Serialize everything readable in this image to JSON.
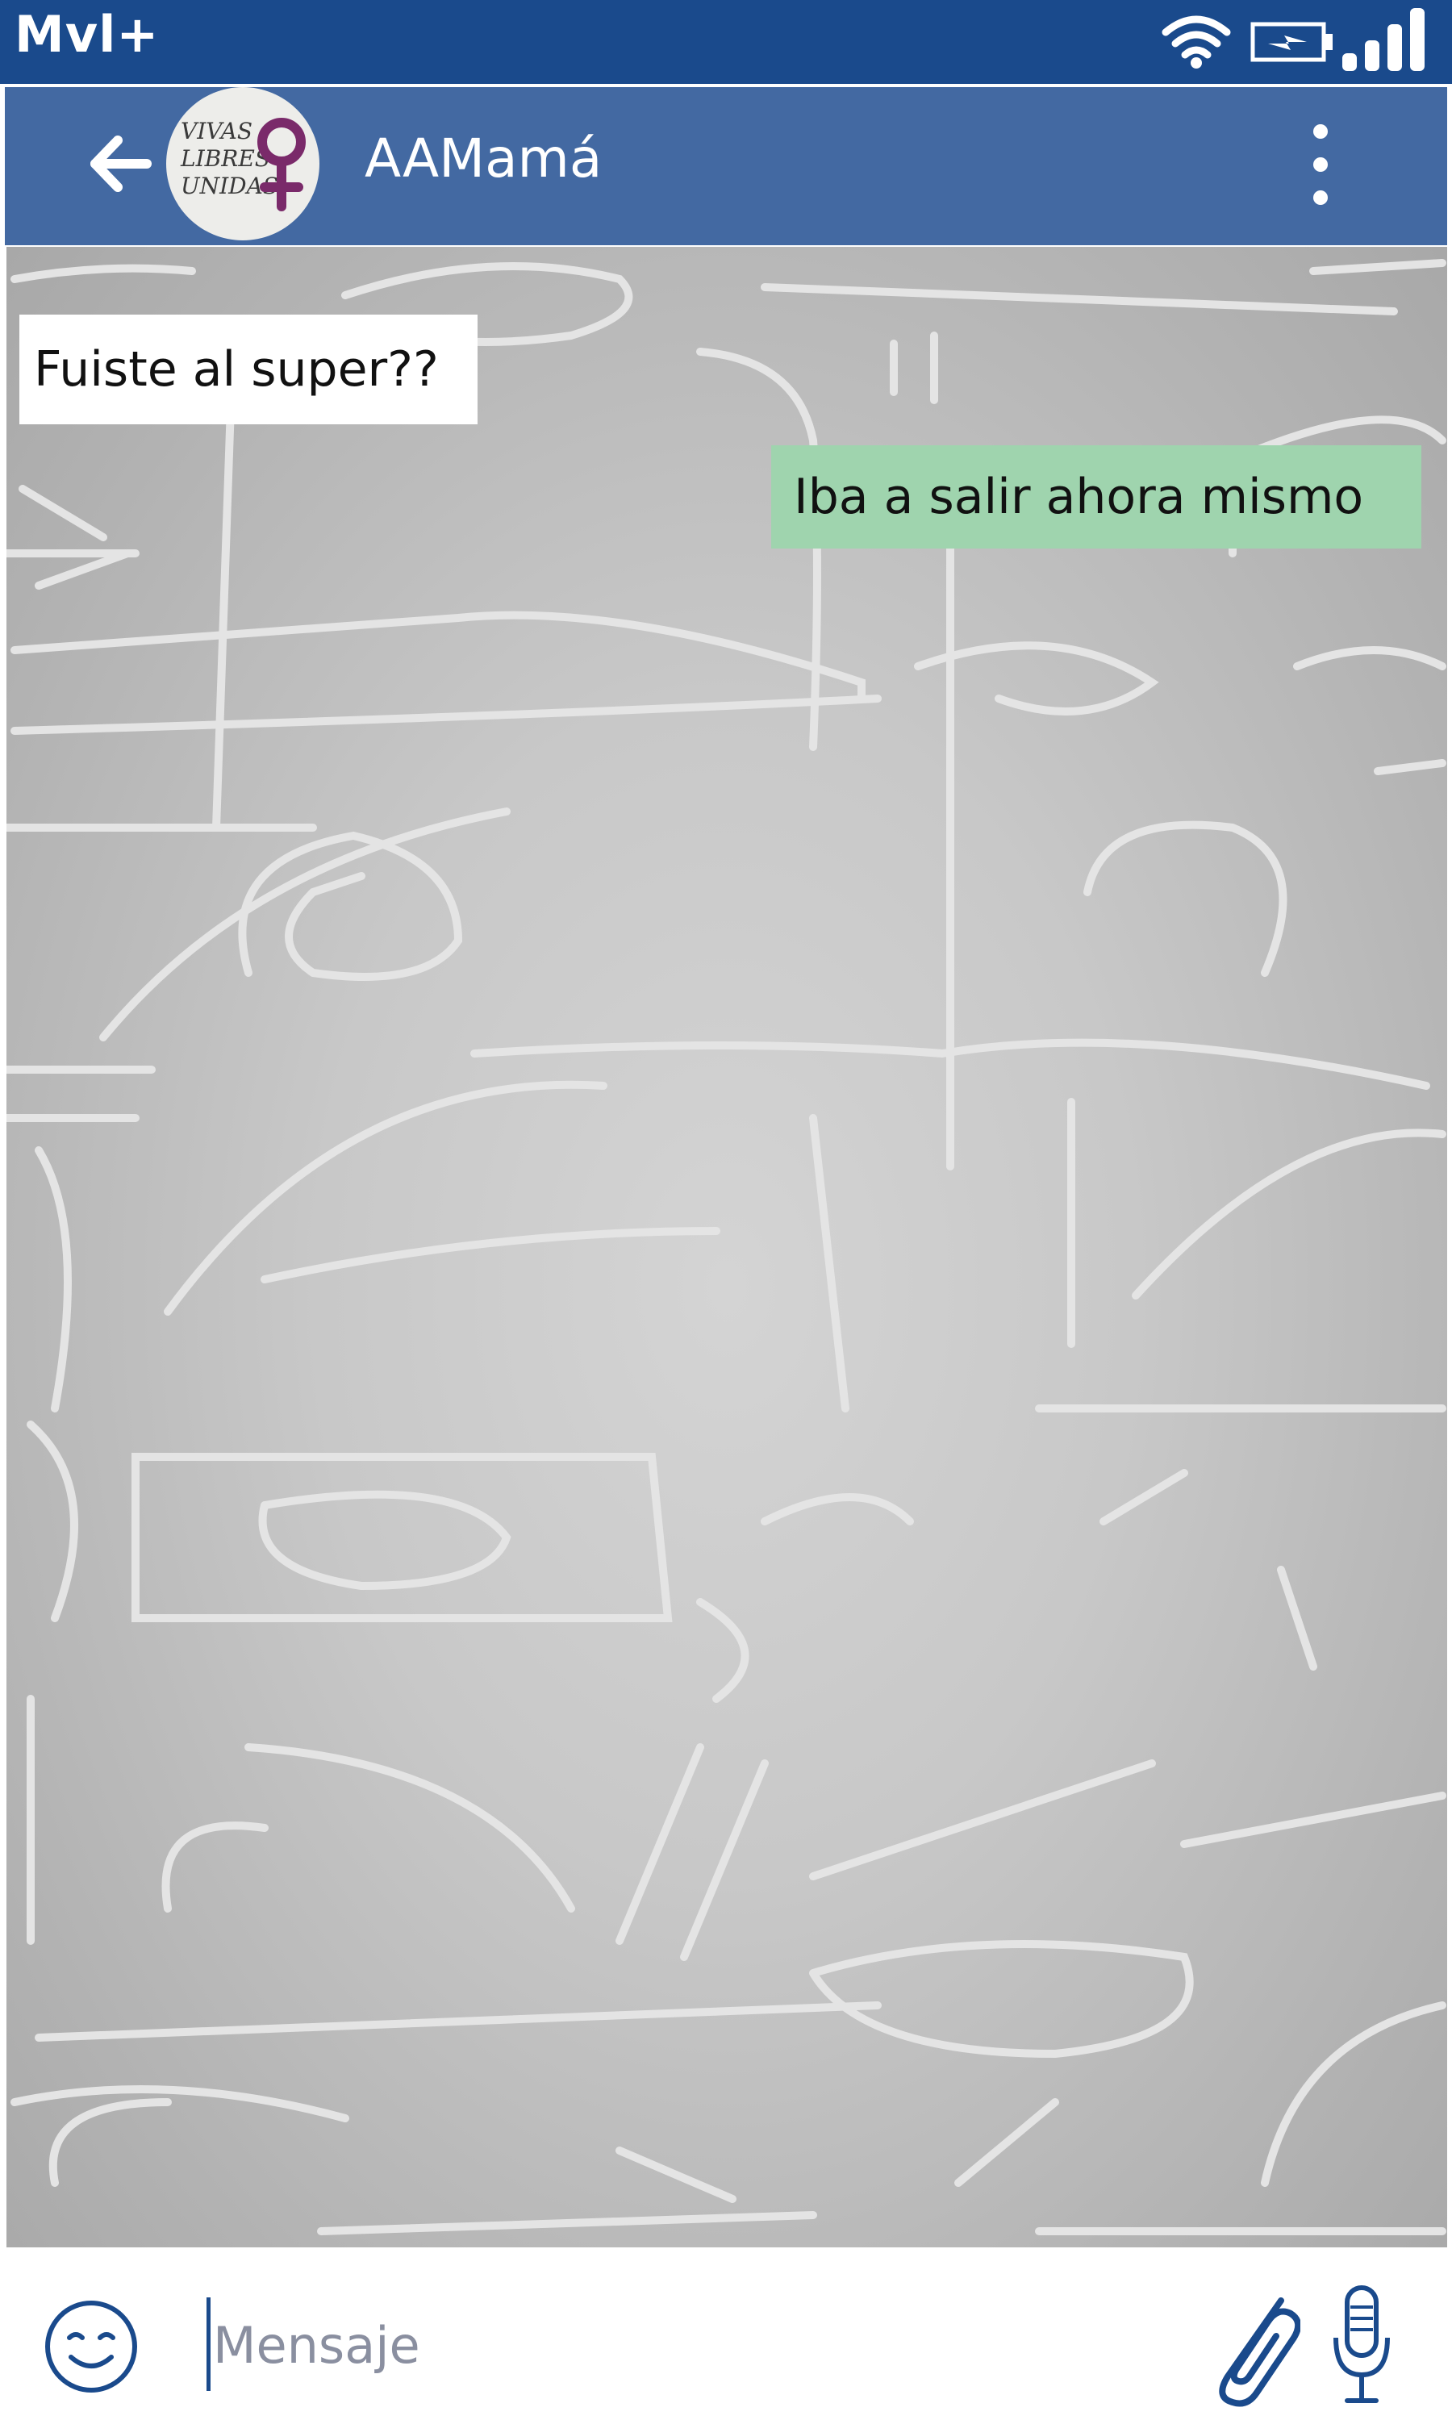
{
  "status_bar": {
    "carrier": "Mvl+",
    "icons": [
      "wifi-icon",
      "battery-charging-icon",
      "signal-icon"
    ]
  },
  "header": {
    "back_icon": "arrow-left-icon",
    "avatar_text": [
      "VIVAS",
      "LIBRES",
      "UNIDAS"
    ],
    "contact_name": "AAMamá",
    "menu_icon": "more-vertical-icon"
  },
  "messages": [
    {
      "direction": "incoming",
      "text": "Fuiste al super??"
    },
    {
      "direction": "outgoing",
      "text": "Iba a salir ahora mismo"
    }
  ],
  "composer": {
    "emoji_icon": "smiley-icon",
    "placeholder": "Mensaje",
    "value": "",
    "attach_icon": "paperclip-icon",
    "mic_icon": "microphone-icon"
  },
  "colors": {
    "status_bar": "#1a4a8c",
    "header": "#4369a2",
    "incoming_bubble": "#ffffff",
    "outgoing_bubble": "#9fd4ae",
    "icon_blue": "#1a4a8c",
    "avatar_symbol": "#7a2a6a"
  }
}
